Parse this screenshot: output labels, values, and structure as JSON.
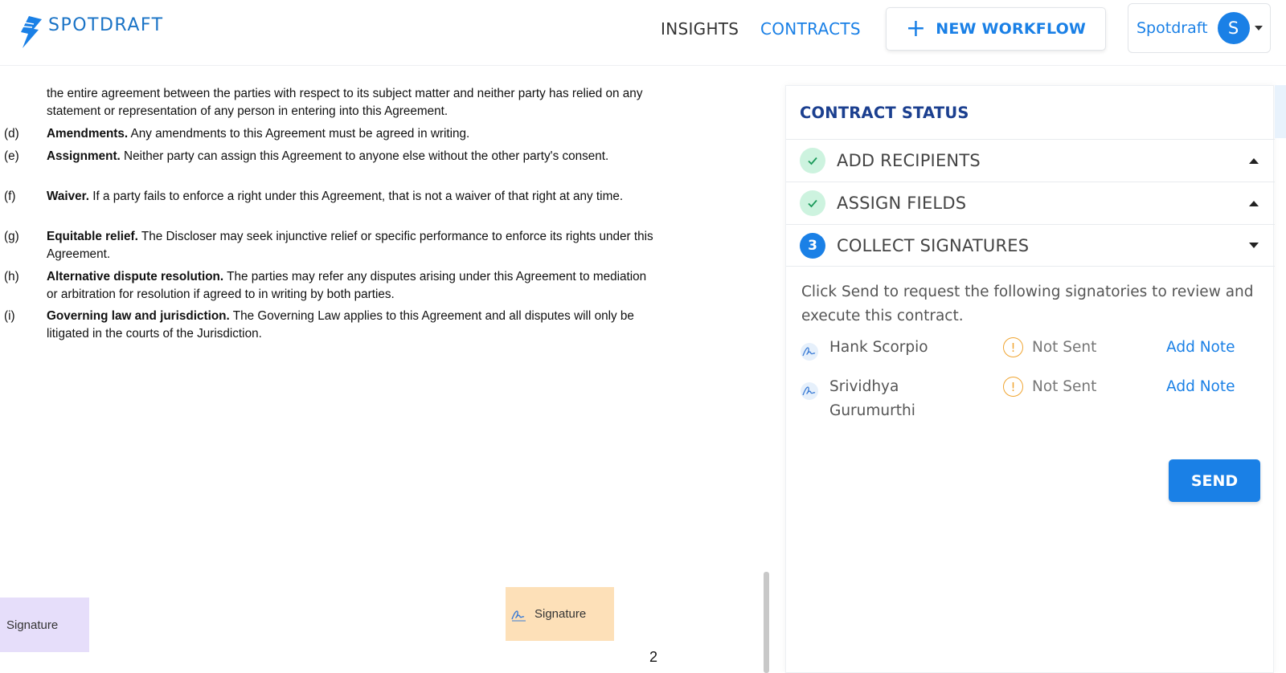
{
  "header": {
    "logo_text": "SPOTDRAFT",
    "nav": {
      "insights": "INSIGHTS",
      "contracts": "CONTRACTS"
    },
    "new_workflow_label": "NEW WORKFLOW",
    "user": {
      "name": "Spotdraft",
      "initial": "S"
    }
  },
  "document": {
    "clauses": [
      {
        "label": "",
        "title": "",
        "text": "the entire agreement between the parties with respect to its subject matter and neither party has relied on any statement or representation of any person in entering into this Agreement."
      },
      {
        "label": "(d)",
        "title": "Amendments.",
        "text": " Any amendments to this Agreement must be agreed in writing."
      },
      {
        "label": "(e)",
        "title": "Assignment.",
        "text": " Neither party can assign this Agreement to anyone else without the other party's consent."
      },
      {
        "label": "(f)",
        "title": "Waiver.",
        "text": " If a party fails to enforce a right under this Agreement, that is not a waiver of that right at any time."
      },
      {
        "label": "(g)",
        "title": "Equitable relief.",
        "text": " The Discloser may seek injunctive relief or specific performance to enforce its rights under this Agreement."
      },
      {
        "label": "(h)",
        "title": "Alternative dispute resolution.",
        "text": " The parties may refer any disputes arising under this Agreement to mediation or arbitration for resolution if agreed to in writing by both parties."
      },
      {
        "label": "(i)",
        "title": "Governing law and jurisdiction.",
        "text": " The Governing Law applies to this Agreement and all disputes will only be litigated in the courts of the Jurisdiction."
      }
    ],
    "signature_field_left": "Signature",
    "signature_field_right": "Signature",
    "page_number": "2"
  },
  "contract_status": {
    "title": "CONTRACT STATUS",
    "steps": [
      {
        "label": "ADD RECIPIENTS",
        "state": "done"
      },
      {
        "label": "ASSIGN FIELDS",
        "state": "done"
      },
      {
        "label": "COLLECT SIGNATURES",
        "state": "active",
        "number": "3"
      }
    ],
    "instructions": "Click Send to request the following signatories to review and execute this contract.",
    "signers": [
      {
        "name": "Hank Scorpio",
        "status": "Not Sent",
        "action": "Add Note"
      },
      {
        "name": "Srividhya Gurumurthi",
        "status": "Not Sent",
        "action": "Add Note"
      }
    ],
    "send_label": "SEND"
  },
  "colors": {
    "brand_blue": "#1a80e6",
    "title_navy": "#1b3f8f",
    "done_green_bg": "#cdf3df",
    "warning_orange": "#f0a531",
    "signature_orange_bg": "#fde0b8",
    "signature_purple_bg": "#e6defa"
  },
  "icons": [
    "spotdraft-logo-icon",
    "plus-icon",
    "chevron-down-icon",
    "check-icon",
    "signature-icon",
    "warning-icon",
    "arrow-up-icon",
    "arrow-down-icon"
  ]
}
